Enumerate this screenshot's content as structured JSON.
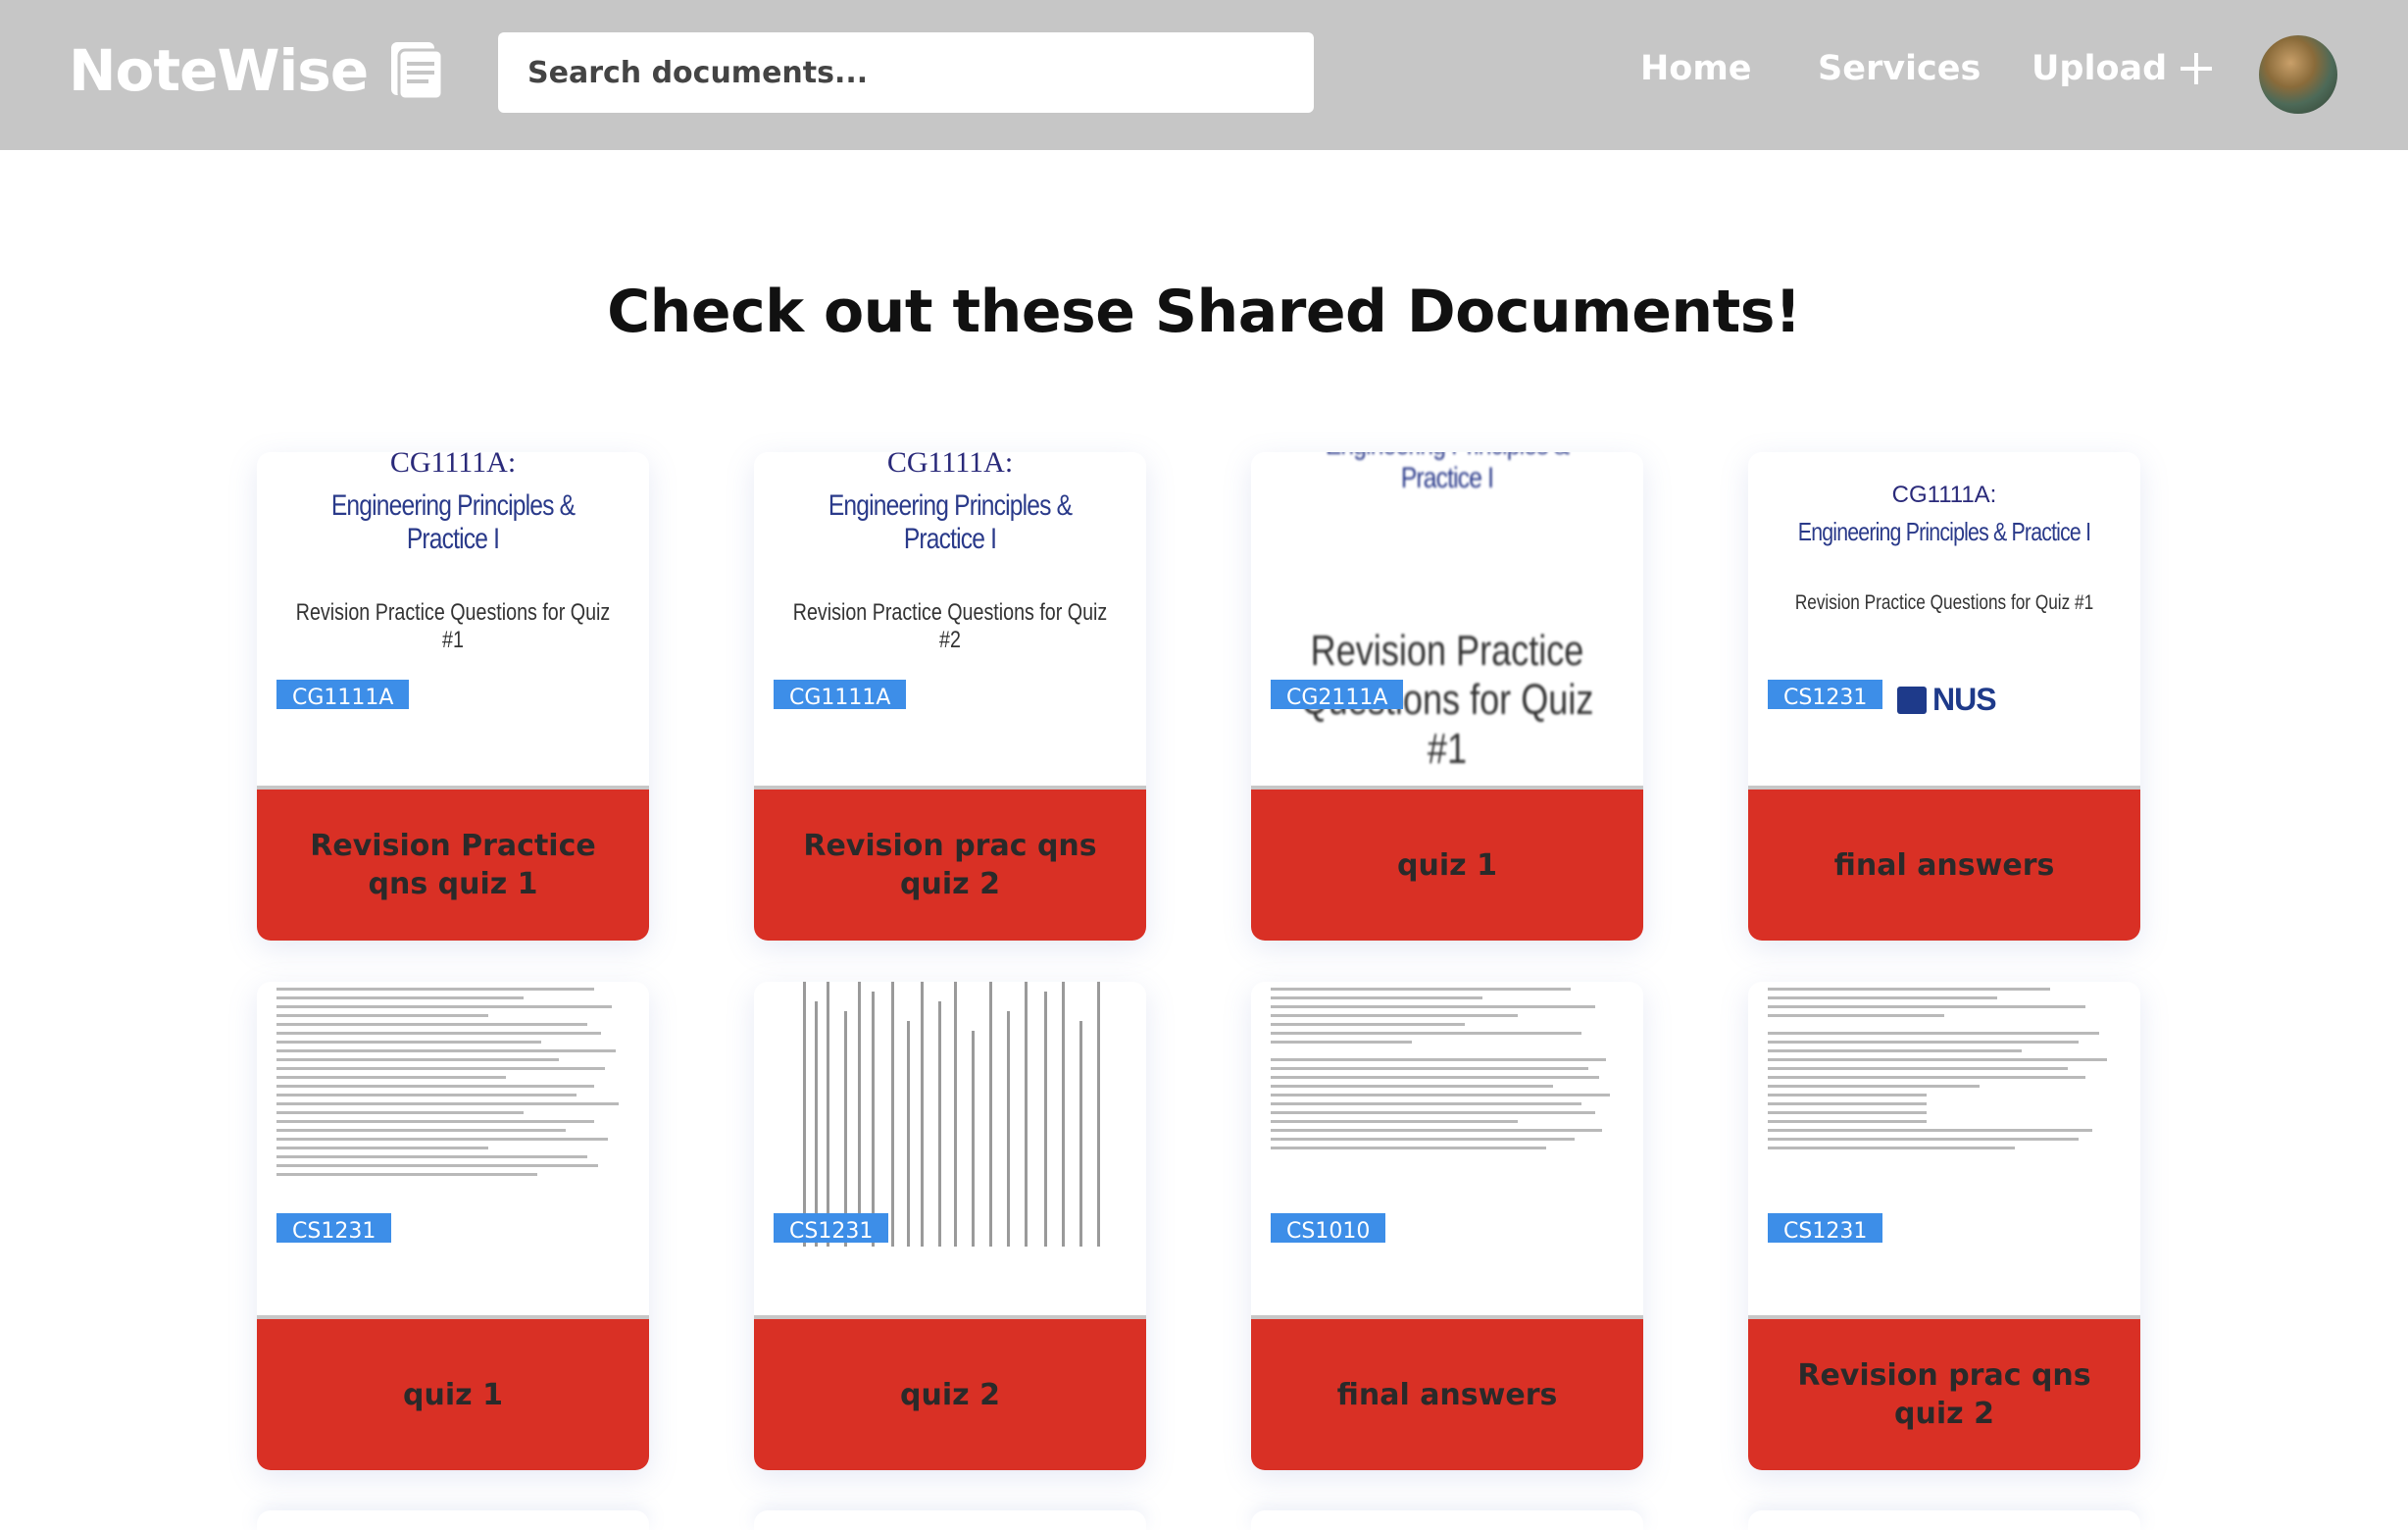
{
  "header": {
    "logo_text": "NoteWise",
    "search_placeholder": "Search documents...",
    "nav": {
      "home": "Home",
      "services": "Services",
      "upload": "Upload"
    }
  },
  "main": {
    "title": "Check out these Shared Documents!"
  },
  "cards": [
    {
      "course": "CG1111A",
      "title": "Revision Practice qns quiz 1",
      "thumb": {
        "course": "CG1111A:",
        "main": "Engineering Principles & Practice I",
        "sub": "Revision Practice Questions for Quiz #1"
      }
    },
    {
      "course": "CG1111A",
      "title": "Revision prac qns quiz 2",
      "thumb": {
        "course": "CG1111A:",
        "main": "Engineering Principles & Practice I",
        "sub": "Revision Practice Questions for Quiz #2"
      }
    },
    {
      "course": "CG2111A",
      "title": "quiz 1",
      "thumb": {
        "course": "",
        "main": "Engineering Principles & Practice I",
        "sub": "Revision Practice Questions for Quiz #1"
      }
    },
    {
      "course": "CS1231",
      "title": "final answers",
      "thumb": {
        "course": "CG1111A:",
        "main": "Engineering Principles & Practice I",
        "sub": "Revision Practice Questions for Quiz #1",
        "logo": "NUS"
      }
    },
    {
      "course": "CS1231",
      "title": "quiz 1"
    },
    {
      "course": "CS1231",
      "title": "quiz 2"
    },
    {
      "course": "CS1010",
      "title": "final answers"
    },
    {
      "course": "CS1231",
      "title": "Revision prac qns quiz 2"
    }
  ],
  "icons": {
    "logo": "document-icon",
    "upload": "plus-icon",
    "avatar": "user-avatar"
  },
  "colors": {
    "header_bg": "#c6c6c6",
    "card_footer": "#d93025",
    "tag": "#3d8ee8"
  }
}
